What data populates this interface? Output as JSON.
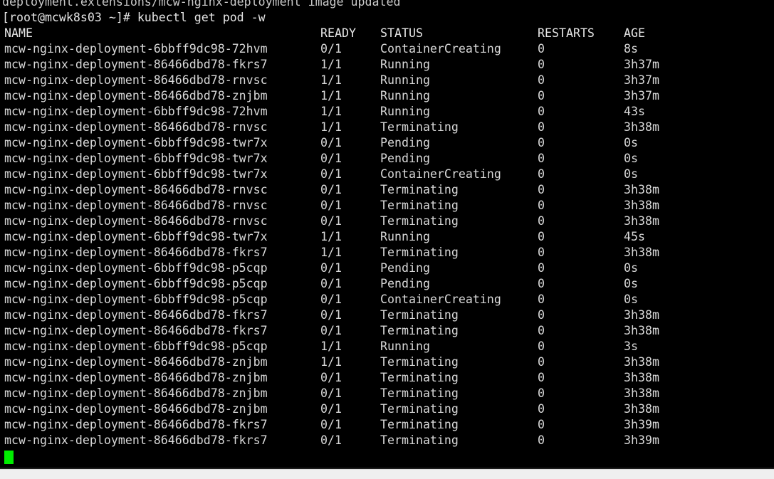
{
  "terminal": {
    "scrollback_line": "deployment.extensions/mcw-nginx-deployment image updated",
    "prompt": "[root@mcwk8s03 ~]# ",
    "command": "kubectl get pod -w",
    "prompt_line": "[root@mcwk8s03 ~]# kubectl get pod -w",
    "user": "root",
    "host": "mcwk8s03",
    "cwd": "~",
    "prompt_symbol": "#",
    "cursor": "block-cursor",
    "colors": {
      "background": "#000000",
      "foreground": "#d8d8d8",
      "cursor": "#00ee00",
      "chrome": "#efefef"
    }
  },
  "table": {
    "columns": [
      "NAME",
      "READY",
      "STATUS",
      "RESTARTS",
      "AGE"
    ],
    "rows": [
      [
        "mcw-nginx-deployment-6bbff9dc98-72hvm",
        "0/1",
        "ContainerCreating",
        "0",
        "8s"
      ],
      [
        "mcw-nginx-deployment-86466dbd78-fkrs7",
        "1/1",
        "Running",
        "0",
        "3h37m"
      ],
      [
        "mcw-nginx-deployment-86466dbd78-rnvsc",
        "1/1",
        "Running",
        "0",
        "3h37m"
      ],
      [
        "mcw-nginx-deployment-86466dbd78-znjbm",
        "1/1",
        "Running",
        "0",
        "3h37m"
      ],
      [
        "mcw-nginx-deployment-6bbff9dc98-72hvm",
        "1/1",
        "Running",
        "0",
        "43s"
      ],
      [
        "mcw-nginx-deployment-86466dbd78-rnvsc",
        "1/1",
        "Terminating",
        "0",
        "3h38m"
      ],
      [
        "mcw-nginx-deployment-6bbff9dc98-twr7x",
        "0/1",
        "Pending",
        "0",
        "0s"
      ],
      [
        "mcw-nginx-deployment-6bbff9dc98-twr7x",
        "0/1",
        "Pending",
        "0",
        "0s"
      ],
      [
        "mcw-nginx-deployment-6bbff9dc98-twr7x",
        "0/1",
        "ContainerCreating",
        "0",
        "0s"
      ],
      [
        "mcw-nginx-deployment-86466dbd78-rnvsc",
        "0/1",
        "Terminating",
        "0",
        "3h38m"
      ],
      [
        "mcw-nginx-deployment-86466dbd78-rnvsc",
        "0/1",
        "Terminating",
        "0",
        "3h38m"
      ],
      [
        "mcw-nginx-deployment-86466dbd78-rnvsc",
        "0/1",
        "Terminating",
        "0",
        "3h38m"
      ],
      [
        "mcw-nginx-deployment-6bbff9dc98-twr7x",
        "1/1",
        "Running",
        "0",
        "45s"
      ],
      [
        "mcw-nginx-deployment-86466dbd78-fkrs7",
        "1/1",
        "Terminating",
        "0",
        "3h38m"
      ],
      [
        "mcw-nginx-deployment-6bbff9dc98-p5cqp",
        "0/1",
        "Pending",
        "0",
        "0s"
      ],
      [
        "mcw-nginx-deployment-6bbff9dc98-p5cqp",
        "0/1",
        "Pending",
        "0",
        "0s"
      ],
      [
        "mcw-nginx-deployment-6bbff9dc98-p5cqp",
        "0/1",
        "ContainerCreating",
        "0",
        "0s"
      ],
      [
        "mcw-nginx-deployment-86466dbd78-fkrs7",
        "0/1",
        "Terminating",
        "0",
        "3h38m"
      ],
      [
        "mcw-nginx-deployment-86466dbd78-fkrs7",
        "0/1",
        "Terminating",
        "0",
        "3h38m"
      ],
      [
        "mcw-nginx-deployment-6bbff9dc98-p5cqp",
        "1/1",
        "Running",
        "0",
        "3s"
      ],
      [
        "mcw-nginx-deployment-86466dbd78-znjbm",
        "1/1",
        "Terminating",
        "0",
        "3h38m"
      ],
      [
        "mcw-nginx-deployment-86466dbd78-znjbm",
        "0/1",
        "Terminating",
        "0",
        "3h38m"
      ],
      [
        "mcw-nginx-deployment-86466dbd78-znjbm",
        "0/1",
        "Terminating",
        "0",
        "3h38m"
      ],
      [
        "mcw-nginx-deployment-86466dbd78-znjbm",
        "0/1",
        "Terminating",
        "0",
        "3h38m"
      ],
      [
        "mcw-nginx-deployment-86466dbd78-fkrs7",
        "0/1",
        "Terminating",
        "0",
        "3h39m"
      ],
      [
        "mcw-nginx-deployment-86466dbd78-fkrs7",
        "0/1",
        "Terminating",
        "0",
        "3h39m"
      ]
    ]
  }
}
